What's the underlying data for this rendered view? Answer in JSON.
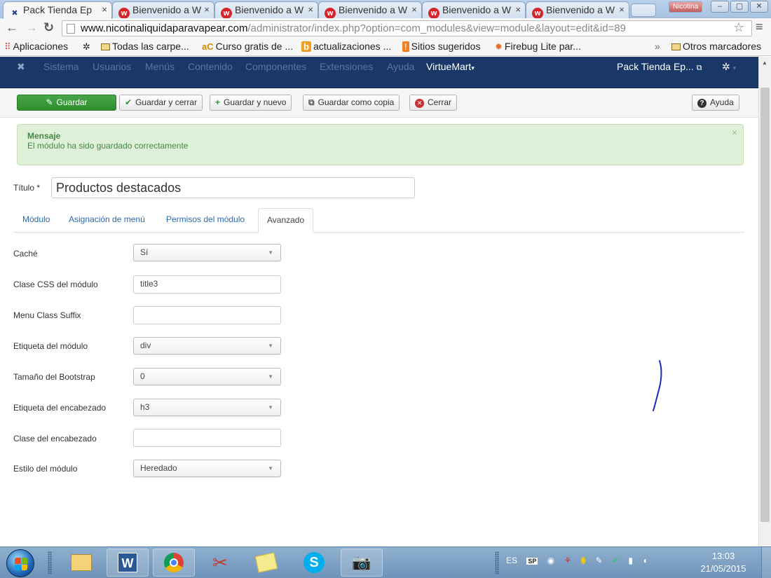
{
  "browser": {
    "tabs": [
      {
        "title": "Pack Tienda Ep",
        "icon": "joomla-icon"
      },
      {
        "title": "Bienvenido a W",
        "icon": "w-icon"
      },
      {
        "title": "Bienvenido a W",
        "icon": "w-icon"
      },
      {
        "title": "Bienvenido a W",
        "icon": "w-icon"
      },
      {
        "title": "Bienvenido a W",
        "icon": "w-icon"
      },
      {
        "title": "Bienvenido a W",
        "icon": "w-icon"
      }
    ],
    "profile": "Nicotina",
    "url_host": "www.nicotinaliquidaparavapear.com",
    "url_path": "/administrator/index.php?option=com_modules&view=module&layout=edit&id=89",
    "bookmarks": {
      "apps": "Aplicaciones",
      "items": [
        "Todas las carpe...",
        "Curso gratis de ...",
        "actualizaciones ...",
        "Sitios sugeridos",
        "Firebug Lite par..."
      ],
      "more": "»",
      "other": "Otros marcadores"
    }
  },
  "admin": {
    "menu": [
      "Sistema",
      "Usuarios",
      "Menús",
      "Contenido",
      "Componentes",
      "Extensiones",
      "Ayuda"
    ],
    "virtuemart": "VirtueMart",
    "site": "Pack Tienda Ep...",
    "settings_caret": "▾"
  },
  "toolbar": {
    "save": "Guardar",
    "save_close": "Guardar y cerrar",
    "save_new": "Guardar y nuevo",
    "save_copy": "Guardar como copia",
    "close": "Cerrar",
    "help": "Ayuda"
  },
  "message": {
    "heading": "Mensaje",
    "text": "El módulo ha sido guardado correctamente",
    "close": "×"
  },
  "form": {
    "title_label": "Título *",
    "title_value": "Productos destacados",
    "tabs": [
      "Módulo",
      "Asignación de menú",
      "Permisos del módulo",
      "Avanzado"
    ],
    "active_tab": "Avanzado",
    "fields": [
      {
        "label": "Caché",
        "value": "Sí",
        "type": "select"
      },
      {
        "label": "Clase CSS del módulo",
        "value": "title3",
        "type": "text"
      },
      {
        "label": "Menu Class Suffix",
        "value": "",
        "type": "text"
      },
      {
        "label": "Etiqueta del módulo",
        "value": "div",
        "type": "select"
      },
      {
        "label": "Tamaño del Bootstrap",
        "value": "0",
        "type": "select"
      },
      {
        "label": "Etiqueta del encabezado",
        "value": "h3",
        "type": "select"
      },
      {
        "label": "Clase del encabezado",
        "value": "",
        "type": "text"
      },
      {
        "label": "Estilo del módulo",
        "value": "Heredado",
        "type": "select"
      }
    ]
  },
  "taskbar": {
    "lang": "ES",
    "time": "13:03",
    "date": "21/05/2015"
  },
  "colors": {
    "admin_bar": "#1a3867",
    "save_green": "#46a546",
    "alert_bg": "#dff0d8",
    "link_blue": "#2a6ab0"
  }
}
